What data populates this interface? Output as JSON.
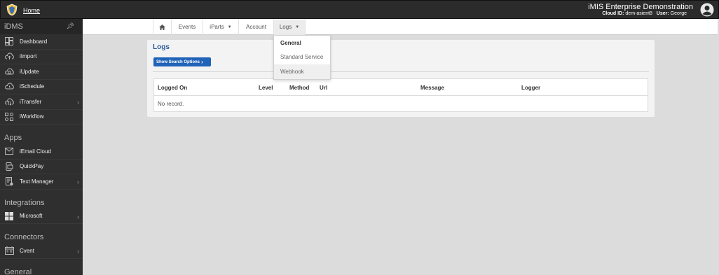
{
  "topbar": {
    "home_label": "Home",
    "app_title": "iMIS Enterprise Demonstration",
    "cloud_id_label": "Cloud ID:",
    "cloud_id_value": "dem-asient8",
    "user_label": "User:",
    "user_value": "George"
  },
  "sidebar": {
    "sections": [
      {
        "title": "iDMS",
        "items": [
          {
            "label": "Dashboard",
            "icon": "dashboard-icon",
            "chevron": false
          },
          {
            "label": "iImport",
            "icon": "cloud-upload-icon",
            "chevron": false
          },
          {
            "label": "iUpdate",
            "icon": "cloud-refresh-icon",
            "chevron": false
          },
          {
            "label": "iSchedule",
            "icon": "cloud-clock-icon",
            "chevron": false
          },
          {
            "label": "iTransfer",
            "icon": "cloud-transfer-icon",
            "chevron": true
          },
          {
            "label": "iWorkflow",
            "icon": "workflow-icon",
            "chevron": false
          }
        ]
      },
      {
        "title": "Apps",
        "items": [
          {
            "label": "iEmail Cloud",
            "icon": "email-icon",
            "chevron": false
          },
          {
            "label": "QuickPay",
            "icon": "payment-icon",
            "chevron": false
          },
          {
            "label": "Text Manager",
            "icon": "text-manager-icon",
            "chevron": true
          }
        ]
      },
      {
        "title": "Integrations",
        "items": [
          {
            "label": "Microsoft",
            "icon": "microsoft-icon",
            "chevron": true
          }
        ]
      },
      {
        "title": "Connectors",
        "items": [
          {
            "label": "Cvent",
            "icon": "cvent-icon",
            "chevron": true
          }
        ]
      },
      {
        "title": "General",
        "items": []
      }
    ]
  },
  "nav": {
    "home_icon": "home-icon",
    "events": "Events",
    "iparts": "iParts",
    "account": "Account",
    "logs": "Logs"
  },
  "logs_menu": {
    "items": [
      "General",
      "Standard Service",
      "Webhook"
    ]
  },
  "main": {
    "title": "Logs",
    "search_button": "Show Search Options",
    "columns": [
      "Logged On",
      "Level",
      "Method",
      "Url",
      "Message",
      "Logger"
    ],
    "empty_text": "No record."
  },
  "colors": {
    "topbar_bg": "#2b2b2b",
    "sidebar_bg": "#2f2f2f",
    "title_blue": "#2d5b9a",
    "button_blue": "#2063b8"
  }
}
